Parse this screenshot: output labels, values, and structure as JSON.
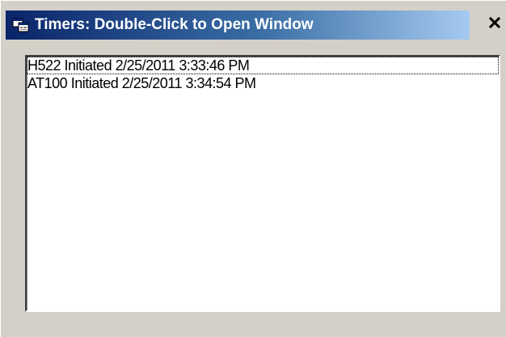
{
  "window": {
    "title": "Timers: Double-Click to Open Window",
    "close_label": "X"
  },
  "timers_list": {
    "items": [
      {
        "label": "H522 Initiated 2/25/2011 3:33:46 PM"
      },
      {
        "label": "AT100 Initiated 2/25/2011 3:34:54 PM"
      }
    ]
  },
  "icons": {
    "app": "application-window-icon",
    "close": "close-icon"
  },
  "colors": {
    "titlebar_start": "#0a246a",
    "titlebar_end": "#a6caf0",
    "window_face": "#d4d0c8",
    "list_background": "#ffffff"
  }
}
